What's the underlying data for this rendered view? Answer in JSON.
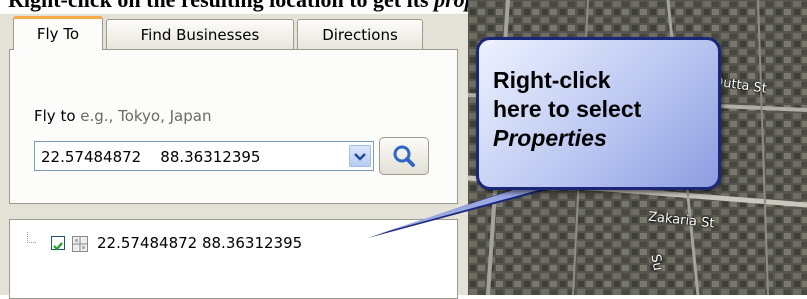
{
  "caption": {
    "text_main": "Right-click on the resulting location to get its ",
    "text_italic": "properties."
  },
  "tabs": [
    {
      "label": "Fly To",
      "active": true
    },
    {
      "label": "Find Businesses",
      "active": false
    },
    {
      "label": "Directions",
      "active": false
    }
  ],
  "fly_to": {
    "label": "Fly to",
    "hint": "e.g., Tokyo, Japan",
    "input_value": "22.57484872    88.36312395",
    "dropdown_icon": "chevron-down-icon",
    "search_icon": "magnifier-icon"
  },
  "places": {
    "items": [
      {
        "label": "22.57484872 88.36312395",
        "checked": true,
        "icon": "placemark-grid-icon"
      }
    ]
  },
  "map": {
    "street_labels": [
      "Dutta St",
      "Zakaria St",
      "Su"
    ]
  },
  "callout": {
    "line1": "Right-click",
    "line2": "here to select",
    "line3": "Properties"
  },
  "colors": {
    "sidebar_bg": "#e4e2d6",
    "active_tab_accent": "#f6a94a",
    "callout_border": "#1a2778",
    "checkbox_check": "#21a121"
  }
}
